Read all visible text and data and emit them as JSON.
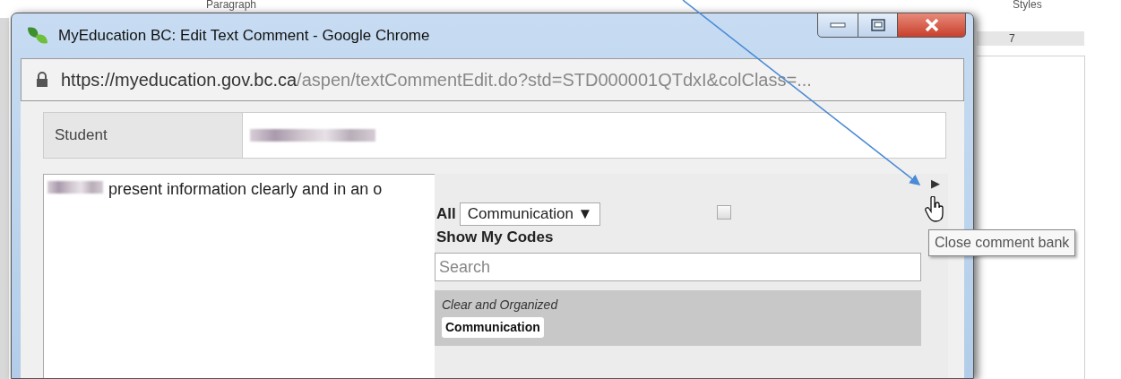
{
  "background_document": {
    "ribbon_labels": [
      "Paragraph",
      "Styles"
    ],
    "ruler_number": "7"
  },
  "window": {
    "title": "MyEducation BC: Edit Text Comment - Google Chrome",
    "url_host": "https://myeducation.gov.bc.ca",
    "url_path": "/aspen/textCommentEdit.do?std=STD000001QTdxI&colClass=..."
  },
  "student": {
    "label": "Student"
  },
  "comment_text": "present information clearly and in an o",
  "comment_bank": {
    "collapse_glyph": "▶",
    "filter_label": "All",
    "category_select": "Communication ▼",
    "show_my_codes": {
      "label": "Show My Codes",
      "checked": false
    },
    "search": {
      "placeholder": "Search"
    },
    "comments": [
      {
        "text": "Clear and Organized",
        "tag": "Communication",
        "selected": true
      }
    ]
  },
  "tooltip": "Close comment bank"
}
